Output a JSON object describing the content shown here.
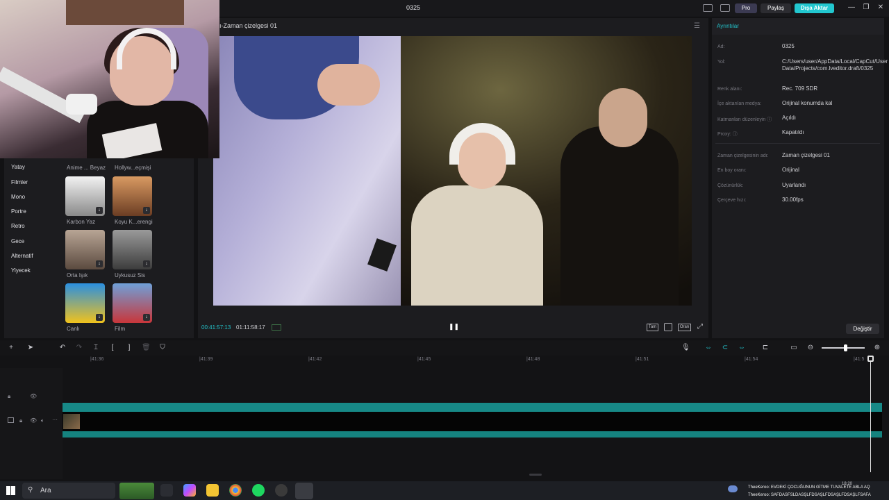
{
  "window": {
    "title": "0325",
    "pro": "Pro",
    "share": "Paylaş",
    "export": "Dışa Aktar",
    "minimize": "—",
    "restore": "❐",
    "close": "✕"
  },
  "left_panel": {
    "categories": [
      "Yatay",
      "Filmler",
      "Mono",
      "Portre",
      "Retro",
      "Gece",
      "Alternatif",
      "Yiyecek"
    ],
    "partial_labels": [
      "Anime ... Beyaz",
      "Hollyw...eçmişi"
    ],
    "filters": [
      {
        "label": "Karbon Yaz"
      },
      {
        "label": "Koyu K...erengi"
      },
      {
        "label": "Orta Işık"
      },
      {
        "label": "Uykusuz Sis"
      },
      {
        "label": "Canlı"
      },
      {
        "label": "Film"
      }
    ]
  },
  "preview": {
    "title": "ı-Zaman çizelgesi 01",
    "time_current": "00:41:57:13",
    "time_total": "01:11:58:17",
    "play_icon": "❚❚",
    "ratio_label": "Tam",
    "ratio2_label": "Oran"
  },
  "details": {
    "header": "Ayrıntılar",
    "rows": [
      {
        "key": "Ad:",
        "value": "0325"
      },
      {
        "key": "Yol:",
        "value": "C:/Users/user/AppData/Local/CapCut/User Data/Projects/com.lveditor.draft/0325"
      },
      {
        "key": "Renk alanı:",
        "value": "Rec. 709 SDR"
      },
      {
        "key": "İçe aktarılan medya:",
        "value": "Orijinal konumda kal"
      },
      {
        "key": "Katmanları düzenleyin ⓘ",
        "value": "Açıldı"
      },
      {
        "key": "Proxy: ⓘ",
        "value": "Kapatıldı"
      },
      {
        "key": "Zaman çizelgesinin adı:",
        "value": "Zaman çizelgesi 01"
      },
      {
        "key": "En boy oranı:",
        "value": "Orijinal"
      },
      {
        "key": "Çözünürlük:",
        "value": "Uyarlandı"
      },
      {
        "key": "Çerçeve hızı:",
        "value": "30.00fps"
      }
    ],
    "change_button": "Değiştir"
  },
  "timeline": {
    "ruler": [
      "|41:36",
      "|41:39",
      "|41:42",
      "|41:45",
      "|41:48",
      "|41:51",
      "|41:54",
      "|41:5"
    ]
  },
  "taskbar": {
    "search_placeholder": "Ara",
    "chat": [
      "TheeKeroo: EVDEKİ ÇOCUĞUNUN GİTME TUVALETE ABLA AQ",
      "TheeKeroo: SAFDASFSLDASŞLFDSAŞLFDSAŞLFDSAŞLFSAFA"
    ],
    "clock": "18:20"
  },
  "colors": {
    "accent": "#23c4cc",
    "export": "#22c7cf",
    "track": "#178987"
  }
}
